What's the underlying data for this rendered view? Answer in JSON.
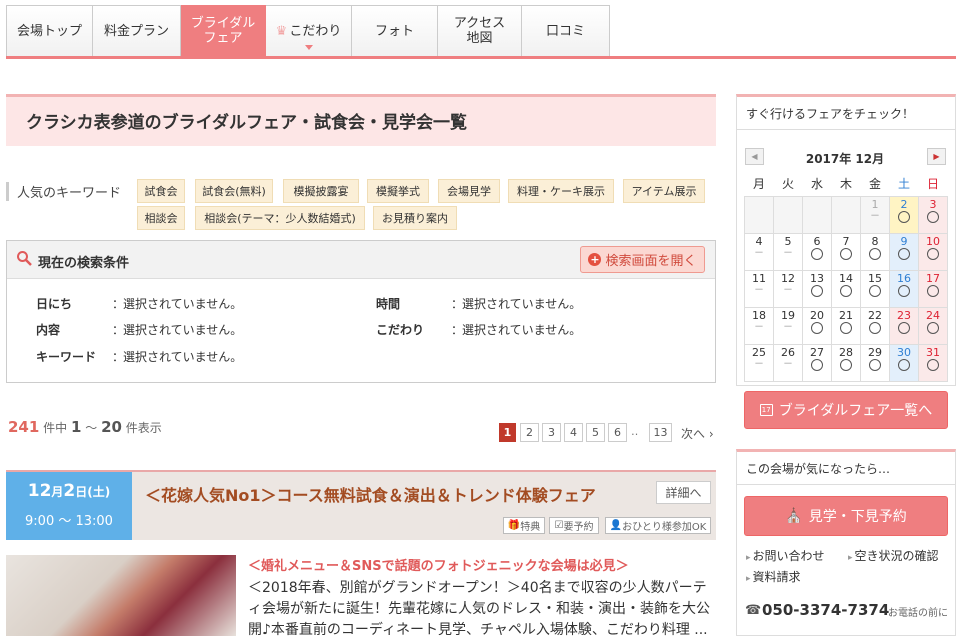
{
  "nav": {
    "tabs": [
      {
        "label": "会場トップ"
      },
      {
        "label": "料金プラン"
      },
      {
        "label": "ブライダル\nフェア"
      },
      {
        "label": "こだわり"
      },
      {
        "label": "フォト"
      },
      {
        "label": "アクセス\n地図"
      },
      {
        "label": "口コミ"
      }
    ]
  },
  "page_title": "クラシカ表参道のブライダルフェア・試食会・見学会一覧",
  "keywords": {
    "label": "人気のキーワード",
    "items": [
      "試食会",
      "試食会(無料)",
      "模擬披露宴",
      "模擬挙式",
      "会場見学",
      "料理・ケーキ展示",
      "アイテム展示",
      "相談会",
      "相談会(テーマ：少人数結婚式)",
      "お見積り案内"
    ]
  },
  "search": {
    "title": "現在の検索条件",
    "open_button": "検索画面を開く",
    "rows": [
      {
        "label": "日にち",
        "sep": "：",
        "value": "選択されていません。"
      },
      {
        "label": "時間",
        "sep": "：",
        "value": "選択されていません。"
      },
      {
        "label": "内容",
        "sep": "：",
        "value": "選択されていません。"
      },
      {
        "label": "こだわり",
        "sep": "：",
        "value": "選択されていません。"
      },
      {
        "label": "キーワード",
        "sep": "：",
        "value": "選択されていません。"
      }
    ]
  },
  "results": {
    "total": "241",
    "total_suffix": "件中",
    "from": "1",
    "tilde": "～",
    "to": "20",
    "suffix": "件表示",
    "pages": [
      "1",
      "2",
      "3",
      "4",
      "5",
      "6"
    ],
    "dots": "‥",
    "last_page": "13",
    "next": "次へ"
  },
  "fair": {
    "day": "12",
    "month_sep": "月",
    "date": "2",
    "date_suffix": "日",
    "weekday": "(土)",
    "time": "9:00 ～ 13:00",
    "title": "＜花嫁人気No1＞コース無料試食＆演出＆トレンド体験フェア",
    "detail_button": "詳細へ",
    "badges": [
      "特典",
      "要予約",
      "おひとり様参加OK"
    ],
    "subtitle": "＜婚礼メニュー＆SNSで話題のフォトジェニックな会場は必見＞",
    "body": "＜2018年春、別館がグランドオープン！＞40名まで収容の少人数パーティ会場が新たに誕生！先輩花嫁に人気のドレス・和装・演出・装飾を大公開♪本番直前のコーディネート見学、チャペル入場体験、こだわり料理 ..."
  },
  "sidebar": {
    "fair_check_title": "すぐ行けるフェアをチェック！",
    "calendar": {
      "prev": "◀",
      "next": "▶",
      "month": "2017年 12月",
      "weekdays": [
        "月",
        "火",
        "水",
        "木",
        "金",
        "土",
        "日"
      ]
    },
    "fair_list_button": "ブライダルフェア一覧へ",
    "interest_title": "この会場が気になったら…",
    "reserve_button": "見学・下見予約",
    "links": [
      "お問い合わせ",
      "空き状況の確認",
      "資料請求"
    ],
    "phone": "050-3374-7374",
    "phone_note": "お電話の前に"
  },
  "colors": {
    "accent": "#ef7e80",
    "date_blue": "#5fb0e8",
    "keyword_bg": "#fbefd7",
    "title_bg": "#fde6e6"
  }
}
